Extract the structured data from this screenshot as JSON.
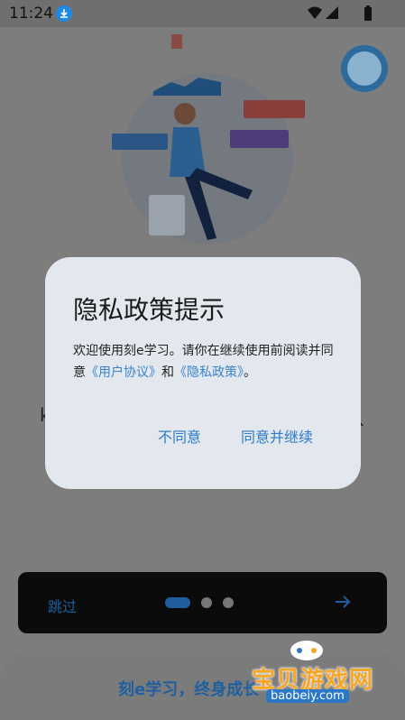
{
  "status_bar": {
    "time": "11:24",
    "download_icon": "download-icon",
    "wifi_icon": "wifi-icon",
    "signal_icon": "signal-icon",
    "battery_icon": "battery-icon"
  },
  "background": {
    "partial_left_text": "k",
    "partial_right_text": "、"
  },
  "onboarding": {
    "skip_label": "跳过",
    "page_count": 3,
    "active_page": 1,
    "next_icon": "arrow-right-icon"
  },
  "bottom": {
    "slogan": "刻e学习，终身成长"
  },
  "watermark": {
    "title": "宝贝游戏网",
    "url": "baobeiy.com"
  },
  "dialog": {
    "title": "隐私政策提示",
    "body_prefix": "欢迎使用刻e学习。请你在继续使用前阅读并同意",
    "user_agreement_link": "《用户协议》",
    "conjunction": "和",
    "privacy_policy_link": "《隐私政策》",
    "body_suffix": "。",
    "disagree_label": "不同意",
    "agree_label": "同意并继续"
  },
  "colors": {
    "accent": "#2d7bc7",
    "dialog_bg": "#e3e8ee",
    "scrim_bg": "#7d7d7d"
  }
}
